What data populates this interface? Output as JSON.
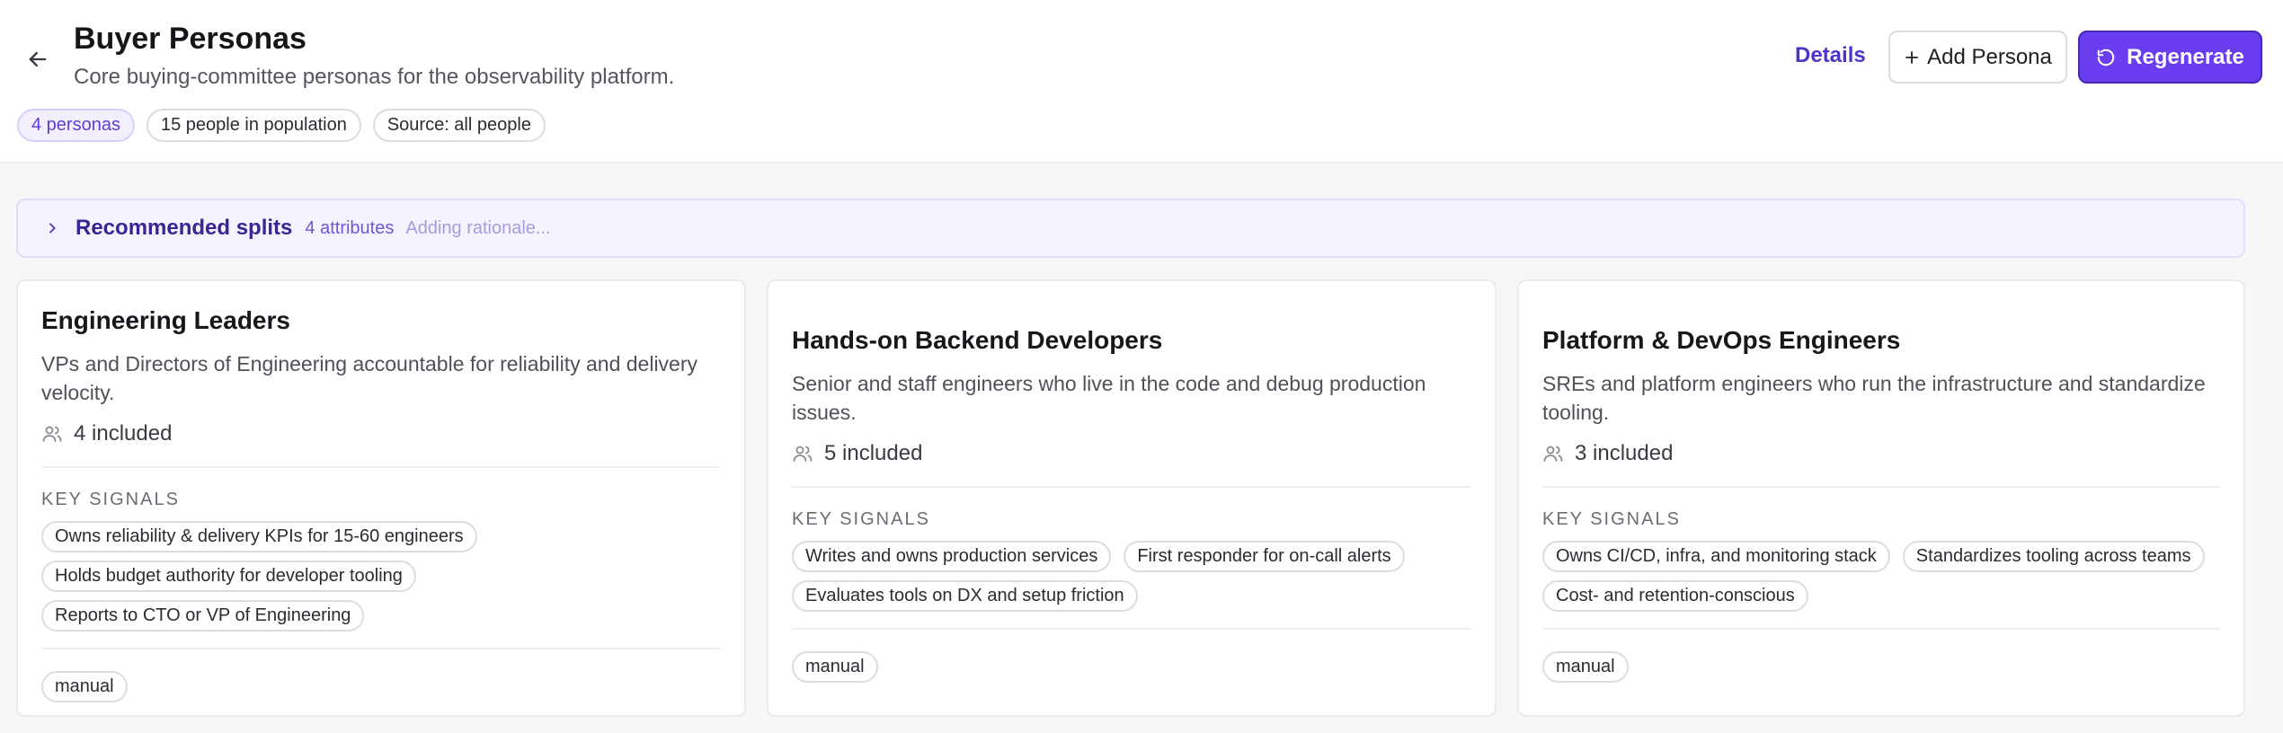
{
  "header": {
    "title": "Buyer Personas",
    "subtitle": "Core buying-committee personas for the observability platform.",
    "back_icon": "arrow-left-icon",
    "pills": [
      "4 personas",
      "15 people in population",
      "Source: all people"
    ],
    "details_label": "Details",
    "add_persona_label": "Add Persona",
    "regenerate_label": "Regenerate",
    "accent_color": "#6a3df0"
  },
  "splits": {
    "title": "Recommended splits",
    "count": "4 attributes",
    "status": "Adding rationale..."
  },
  "signals_heading": "KEY SIGNALS",
  "personas": [
    {
      "name": "Engineering Leaders",
      "description": "VPs and Directors of Engineering accountable for reliability and delivery velocity.",
      "included": "4 included",
      "signals": [
        "Owns reliability & delivery KPIs for 15-60 engineers",
        "Holds budget authority for developer tooling",
        "Reports to CTO or VP of Engineering"
      ],
      "source": "manual"
    },
    {
      "name": "Hands-on Backend Developers",
      "description": "Senior and staff engineers who live in the code and debug production issues.",
      "included": "5 included",
      "signals": [
        "Writes and owns production services",
        "First responder for on-call alerts",
        "Evaluates tools on DX and setup friction"
      ],
      "source": "manual"
    },
    {
      "name": "Platform & DevOps Engineers",
      "description": "SREs and platform engineers who run the infrastructure and standardize tooling.",
      "included": "3 included",
      "signals": [
        "Owns CI/CD, infra, and monitoring stack",
        "Standardizes tooling across teams",
        "Cost- and retention-conscious"
      ],
      "source": "manual"
    }
  ]
}
